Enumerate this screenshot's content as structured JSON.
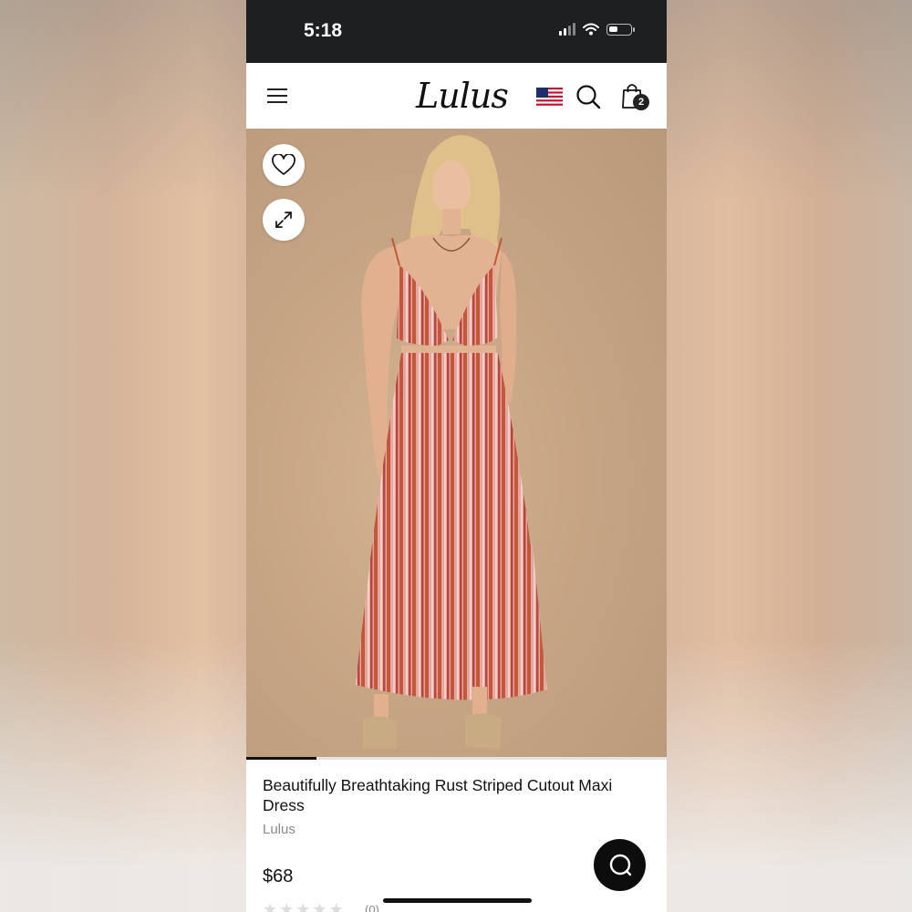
{
  "status_bar": {
    "time": "5:18"
  },
  "header": {
    "logo": "Lulus",
    "cart_count": "2"
  },
  "gallery": {
    "current_image": 1,
    "image_count": 6
  },
  "product": {
    "title": "Beautifully Breathtaking Rust Striped Cutout Maxi Dress",
    "brand": "Lulus",
    "price": "$68",
    "rating": 0,
    "reviews": "(0)"
  },
  "colors": {
    "status_bar": "#1e1f21",
    "dress_rust": "#c2583a",
    "dress_pink": "#e7a6a2",
    "backdrop": "#c6a585"
  },
  "icons": [
    "hamburger-icon",
    "us-flag-icon",
    "search-icon",
    "shopping-bag-icon",
    "heart-icon",
    "expand-icon",
    "chat-icon",
    "star-icon"
  ]
}
